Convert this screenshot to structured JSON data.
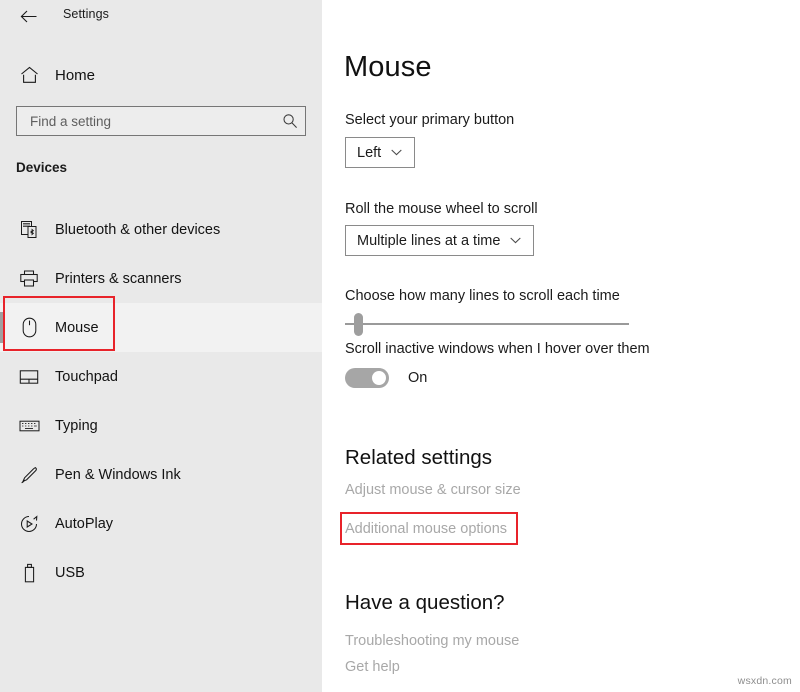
{
  "window": {
    "app_title": "Settings",
    "back_icon": "back-arrow-icon"
  },
  "sidebar": {
    "home": {
      "label": "Home",
      "icon": "home-icon"
    },
    "search": {
      "placeholder": "Find a setting",
      "value": "",
      "icon": "search-icon"
    },
    "group_title": "Devices",
    "items": [
      {
        "label": "Bluetooth & other devices",
        "icon": "bluetooth-devices-icon",
        "selected": false
      },
      {
        "label": "Printers & scanners",
        "icon": "printer-icon",
        "selected": false
      },
      {
        "label": "Mouse",
        "icon": "mouse-icon",
        "selected": true
      },
      {
        "label": "Touchpad",
        "icon": "touchpad-icon",
        "selected": false
      },
      {
        "label": "Typing",
        "icon": "keyboard-icon",
        "selected": false
      },
      {
        "label": "Pen & Windows Ink",
        "icon": "pen-icon",
        "selected": false
      },
      {
        "label": "AutoPlay",
        "icon": "autoplay-icon",
        "selected": false
      },
      {
        "label": "USB",
        "icon": "usb-icon",
        "selected": false
      }
    ]
  },
  "main": {
    "page_title": "Mouse",
    "primary_button": {
      "label": "Select your primary button",
      "value": "Left",
      "caret_icon": "chevron-down-icon"
    },
    "wheel_scroll": {
      "label": "Roll the mouse wheel to scroll",
      "value": "Multiple lines at a time",
      "caret_icon": "chevron-down-icon"
    },
    "lines_slider": {
      "label": "Choose how many lines to scroll each time",
      "percent": 3
    },
    "inactive_scroll": {
      "label": "Scroll inactive windows when I hover over them",
      "state": "On"
    },
    "related_settings": {
      "heading": "Related settings",
      "links": [
        "Adjust mouse & cursor size",
        "Additional mouse options"
      ]
    },
    "have_question": {
      "heading": "Have a question?",
      "links": [
        "Troubleshooting my mouse",
        "Get help"
      ]
    }
  },
  "annotations": {
    "highlight_color": "#e8232a",
    "boxes": [
      "Mouse",
      "Additional mouse options"
    ]
  },
  "watermark": "wsxdn.com"
}
